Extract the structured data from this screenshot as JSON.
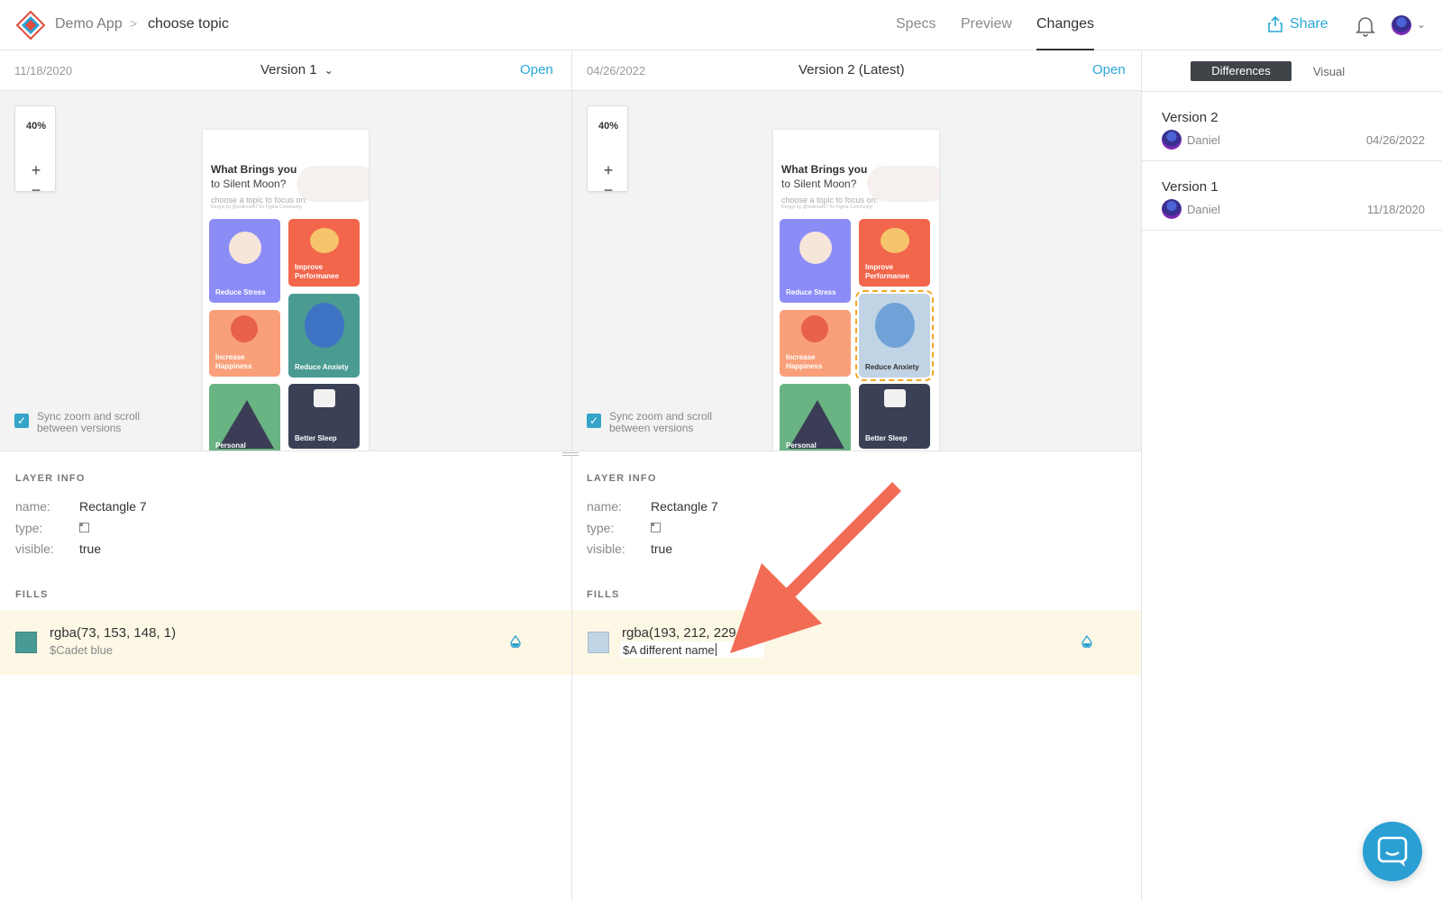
{
  "header": {
    "app_name": "Demo App",
    "separator": ">",
    "page_name": "choose topic",
    "tabs": [
      "Specs",
      "Preview",
      "Changes"
    ],
    "active_tab": "Changes",
    "share_label": "Share"
  },
  "left_version": {
    "date": "11/18/2020",
    "name": "Version 1",
    "open_label": "Open",
    "zoom": "40%",
    "sync_label": "Sync zoom and scroll between versions"
  },
  "right_version": {
    "date": "04/26/2022",
    "name": "Version 2 (Latest)",
    "open_label": "Open",
    "zoom": "40%",
    "sync_label": "Sync zoom and scroll between versions"
  },
  "zoom_controls": {
    "plus": "+",
    "minus": "−"
  },
  "phone": {
    "title_line1": "What Brings you",
    "title_line2": "to Silent Moon?",
    "subtitle": "choose a topic to focus on:",
    "credit": "Design by @ordinool67 for Figma Community",
    "cards": [
      {
        "label": "Reduce Stress",
        "color": "#8c8cf7"
      },
      {
        "label": "Improve Performanee",
        "color": "#f2664b"
      },
      {
        "label": "Increase Happiness",
        "color": "#f9a07a"
      },
      {
        "label": "Reduce Anxiety",
        "color": "#4a9b92"
      },
      {
        "label": "Personal",
        "color": "#6ab383"
      },
      {
        "label": "Better Sleep",
        "color": "#3a4156"
      }
    ],
    "changed_card_color_v2": "#c1d4e5"
  },
  "right_panel": {
    "segments": [
      "Differences",
      "Visual"
    ],
    "active_segment": "Differences",
    "versions": [
      {
        "title": "Version 2",
        "user": "Daniel",
        "date": "04/26/2022"
      },
      {
        "title": "Version 1",
        "user": "Daniel",
        "date": "11/18/2020"
      }
    ]
  },
  "layer_left": {
    "section_label": "LAYER INFO",
    "name_key": "name:",
    "name_val": "Rectangle 7",
    "type_key": "type:",
    "visible_key": "visible:",
    "visible_val": "true",
    "fills_label": "FILLS",
    "fill_value": "rgba(73, 153, 148, 1)",
    "fill_name": "$Cadet blue",
    "swatch_color": "#499994"
  },
  "layer_right": {
    "section_label": "LAYER INFO",
    "name_key": "name:",
    "name_val": "Rectangle 7",
    "type_key": "type:",
    "visible_key": "visible:",
    "visible_val": "true",
    "fills_label": "FILLS",
    "fill_value": "rgba(193, 212, 229",
    "fill_name": "$A different name",
    "swatch_color": "#c1d4e5"
  },
  "colors": {
    "accent": "#29a8d8",
    "highlight_row": "#fdf8e6",
    "annotation_arrow": "#f26b55",
    "chat": "#2a9fd3"
  }
}
